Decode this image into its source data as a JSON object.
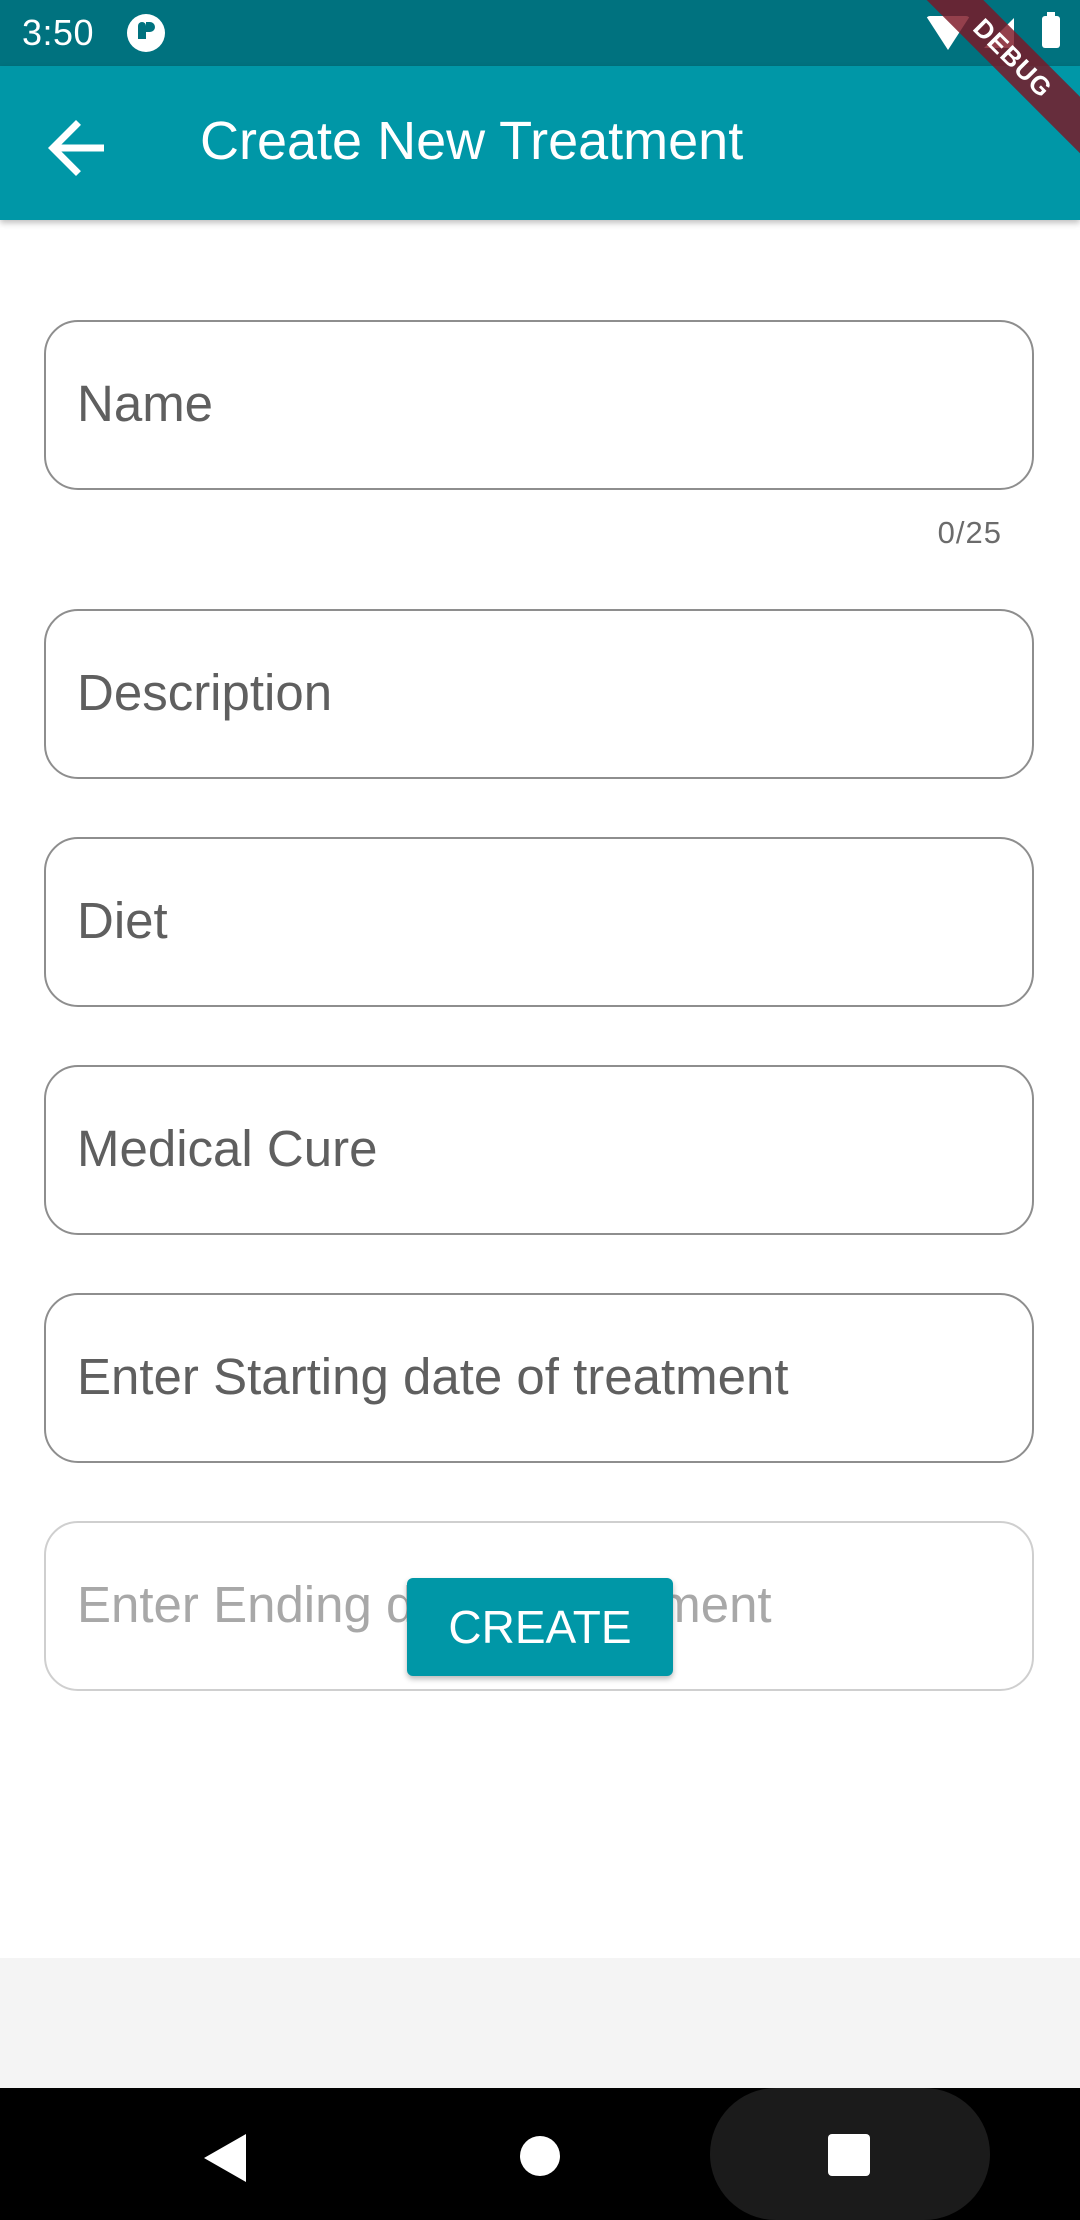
{
  "status_bar": {
    "time": "3:50",
    "app_icon": "app-notification-icon",
    "wifi_icon": "wifi-icon",
    "signal_icon": "signal-icon",
    "battery_icon": "battery-icon"
  },
  "app_bar": {
    "back_icon": "arrow-back-icon",
    "title": "Create New Treatment",
    "debug_banner": "DEBUG",
    "background_color": "#0097a7"
  },
  "form": {
    "name": {
      "placeholder": "Name",
      "value": "",
      "counter": "0/25"
    },
    "description": {
      "placeholder": "Description",
      "value": ""
    },
    "diet": {
      "placeholder": "Diet",
      "value": ""
    },
    "medical_cure": {
      "placeholder": "Medical Cure",
      "value": ""
    },
    "start_date": {
      "placeholder": "Enter Starting date of treatment",
      "value": ""
    },
    "end_date": {
      "placeholder": "Enter Ending date of treatment",
      "value": "",
      "disabled": true
    },
    "create_button": {
      "label": "CREATE"
    }
  },
  "nav_bar": {
    "back_icon": "nav-back-icon",
    "home_icon": "nav-home-icon",
    "recents_icon": "nav-recents-icon"
  },
  "colors": {
    "accent": "#0097a7",
    "status_bar": "#00727f",
    "field_border": "#8e8e8e",
    "debug_ribbon": "#7c1624"
  }
}
